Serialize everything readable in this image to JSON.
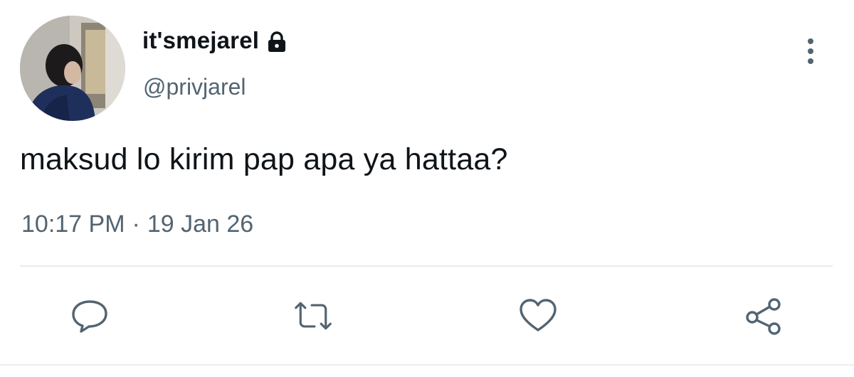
{
  "user": {
    "display_name": "it'smejarel",
    "handle": "@privjarel",
    "protected_icon": "lock-icon",
    "avatar_icon": "profile-photo"
  },
  "tweet": {
    "text": "maksud lo kirim pap apa ya hattaa?",
    "time": "10:17 PM",
    "separator": "·",
    "date": "19 Jan 26"
  },
  "actions": [
    {
      "icon": "reply-icon"
    },
    {
      "icon": "retweet-icon"
    },
    {
      "icon": "like-icon"
    },
    {
      "icon": "share-icon"
    }
  ],
  "menu_icon": "more-vertical-icon",
  "colors": {
    "text": "#0f1419",
    "secondary": "#536471",
    "divider": "#e7eaed"
  }
}
